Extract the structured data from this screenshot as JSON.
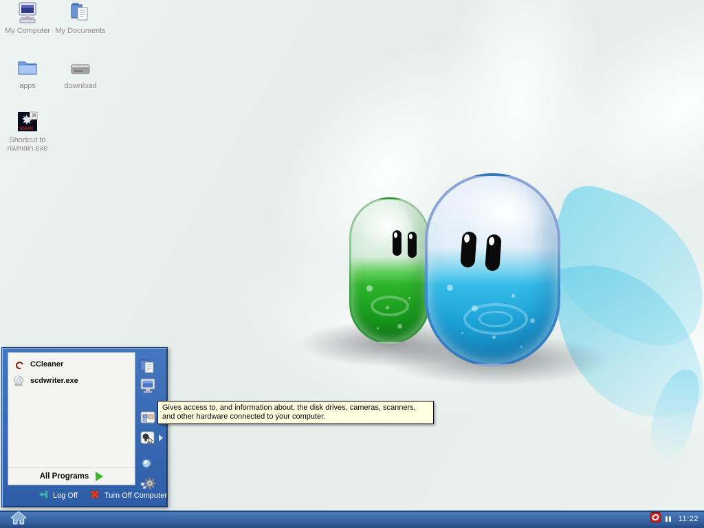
{
  "desktop": {
    "icons": [
      {
        "icon": "my-computer-icon",
        "label": "My Computer"
      },
      {
        "icon": "my-documents-icon",
        "label": "My Documents"
      },
      {
        "icon": "folder-icon",
        "label": "apps"
      },
      {
        "icon": "drive-icon",
        "label": "download"
      },
      {
        "icon": "nwmain-shortcut-icon",
        "label": "Shortcut to nwmain.exe",
        "icon_text": "MAIN"
      }
    ],
    "wallpaper": "two glossy pill characters (green and blue) with cyan fin on light swirl background"
  },
  "start_menu": {
    "programs": [
      {
        "icon": "ccleaner-icon",
        "label": "CCleaner"
      },
      {
        "icon": "cd-writer-icon",
        "label": "scdwriter.exe"
      }
    ],
    "all_programs": "All Programs",
    "log_off": "Log Off",
    "turn_off": "Turn Off Computer",
    "right_icons": [
      "my-documents-icon",
      "my-computer-icon",
      "control-panel-icon",
      "hardware-icon",
      "search-icon",
      "run-gear-icon"
    ]
  },
  "tooltip": {
    "text": "Gives access to, and information about, the disk drives, cameras, scanners, and other hardware connected to your computer."
  },
  "taskbar": {
    "clock": "11:22",
    "tray_icons": [
      "red-sync-icon",
      "pause-indicator-icon"
    ]
  },
  "colors": {
    "menu_blue": "#3a6db6",
    "taskbar_blue": "#3c6aa9",
    "tooltip_bg": "#ffffe1",
    "accent_green": "#3cb52d",
    "logoff_teal": "#53b7c9",
    "turnoff_red": "#e04426",
    "pill_green": "#2db32c",
    "pill_blue": "#34bce8"
  }
}
